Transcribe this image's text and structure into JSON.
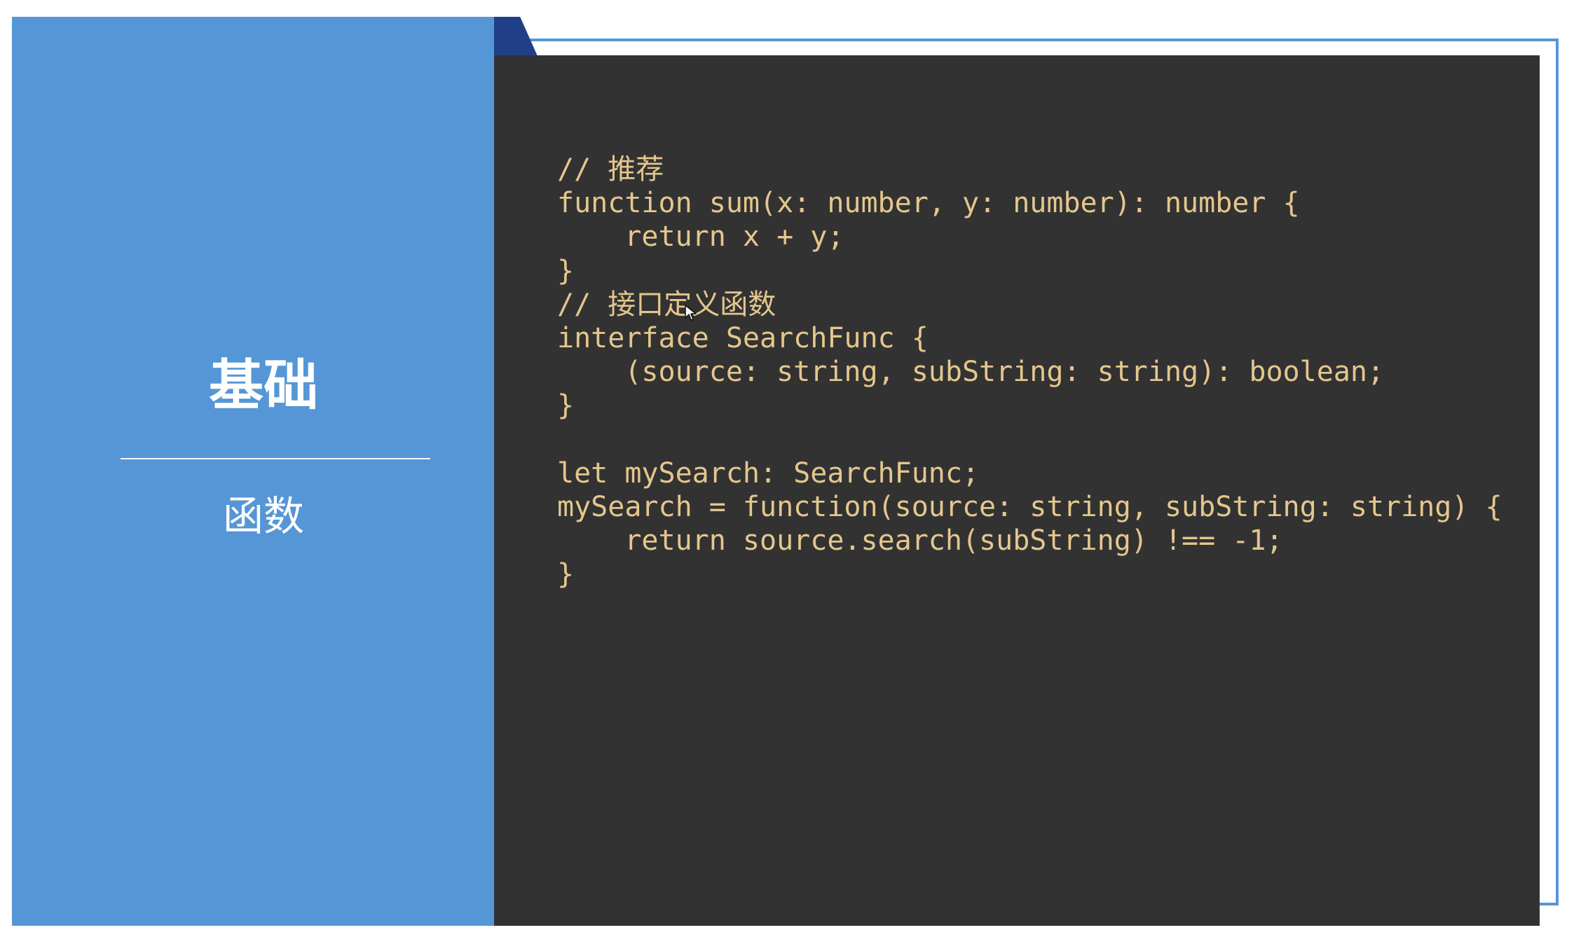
{
  "left_panel": {
    "title": "基础",
    "subtitle": "函数"
  },
  "code_panel": {
    "lines": [
      "// 推荐",
      "function sum(x: number, y: number): number {",
      "    return x + y;",
      "}",
      "// 接口定义函数",
      "interface SearchFunc {",
      "    (source: string, subString: string): boolean;",
      "}",
      "",
      "let mySearch: SearchFunc;",
      "mySearch = function(source: string, subString: string) {",
      "    return source.search(subString) !== -1;",
      "}"
    ]
  },
  "colors": {
    "left_panel": "#5596d6",
    "code_background": "#333233",
    "code_text": "#e3c78c",
    "outline": "#5596d6",
    "accent_tab": "#203f86"
  },
  "icons": {
    "cursor": "mouse-pointer-icon"
  }
}
